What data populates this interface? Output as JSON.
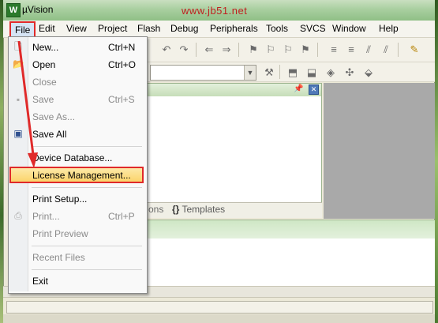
{
  "window": {
    "title": "µVision",
    "watermark": "www.jb51.net"
  },
  "menubar": {
    "items": [
      "File",
      "Edit",
      "View",
      "Project",
      "Flash",
      "Debug",
      "Peripherals",
      "Tools",
      "SVCS",
      "Window",
      "Help"
    ]
  },
  "file_menu": {
    "new": {
      "label": "New...",
      "shortcut": "Ctrl+N"
    },
    "open": {
      "label": "Open",
      "shortcut": "Ctrl+O"
    },
    "close": {
      "label": "Close"
    },
    "save": {
      "label": "Save",
      "shortcut": "Ctrl+S"
    },
    "save_as": {
      "label": "Save As..."
    },
    "save_all": {
      "label": "Save All"
    },
    "device_database": {
      "label": "Device Database..."
    },
    "license_management": {
      "label": "License Management..."
    },
    "print_setup": {
      "label": "Print Setup..."
    },
    "print": {
      "label": "Print...",
      "shortcut": "Ctrl+P"
    },
    "print_preview": {
      "label": "Print Preview"
    },
    "recent_files": {
      "label": "Recent Files"
    },
    "exit": {
      "label": "Exit"
    }
  },
  "panel": {
    "tab_functions": "ons",
    "tab_templates": "Templates",
    "tab_templates_icon": "{}"
  },
  "colors": {
    "highlight_border": "#e02a2a",
    "menu_highlight": "#fbd46b",
    "app_icon": "#2b7a2b"
  },
  "icons": [
    "pin-icon",
    "close-icon",
    "new-file-icon",
    "open-folder-icon",
    "save-icon",
    "save-all-icon",
    "print-icon",
    "templates-icon"
  ]
}
